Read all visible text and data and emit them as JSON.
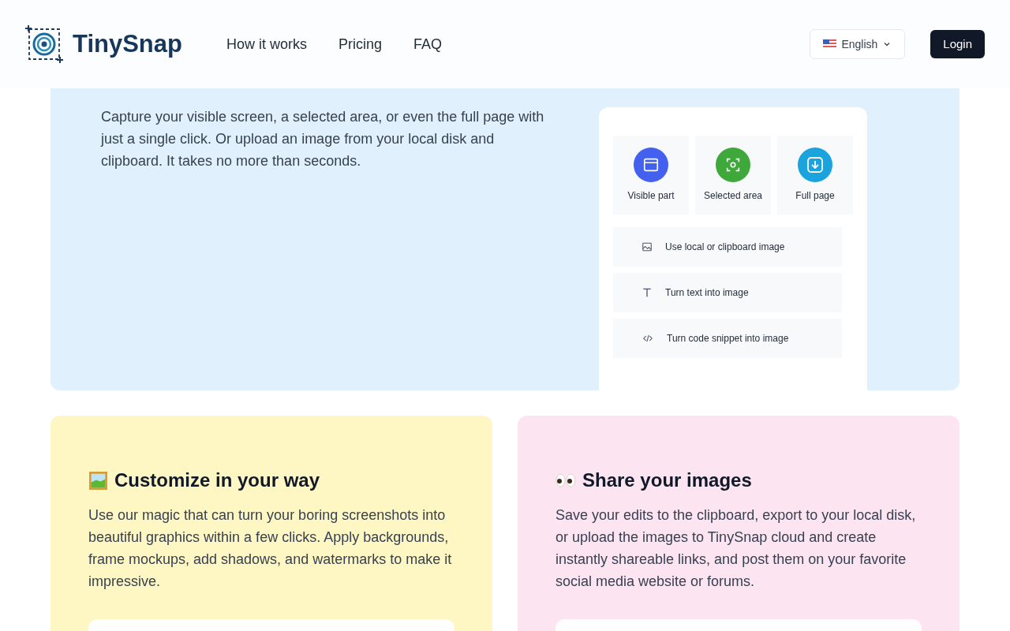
{
  "header": {
    "logo_text": "TinySnap",
    "nav": [
      "How it works",
      "Pricing",
      "FAQ"
    ],
    "language": "English",
    "login": "Login"
  },
  "hero": {
    "description": "Capture your visible screen, a selected area, or even the full page with just a single click. Or upload an image from your local disk and clipboard. It takes no more than seconds.",
    "capture_options": [
      {
        "kind": "visible",
        "label": "Visible part",
        "color": "#4361ee"
      },
      {
        "kind": "area",
        "label": "Selected area",
        "color": "#3fa83a"
      },
      {
        "kind": "full",
        "label": "Full page",
        "color": "#1aa3dc"
      }
    ],
    "actions": [
      {
        "kind": "image",
        "label": "Use local or clipboard image"
      },
      {
        "kind": "text",
        "label": "Turn text into image"
      },
      {
        "kind": "code",
        "label": "Turn code snippet into image"
      }
    ]
  },
  "features": [
    {
      "kind": "frame",
      "title": "Customize in your way",
      "description": "Use our magic that can turn your boring screenshots into beautiful graphics within a few clicks. Apply backgrounds, frame mockups, add shadows, and watermarks to make it impressive."
    },
    {
      "kind": "eyes",
      "title": "Share your images",
      "description": "Save your edits to the clipboard, export to your local disk, or upload the images to TinySnap cloud and create instantly shareable links, and post them on your favorite social media website or forums."
    }
  ]
}
